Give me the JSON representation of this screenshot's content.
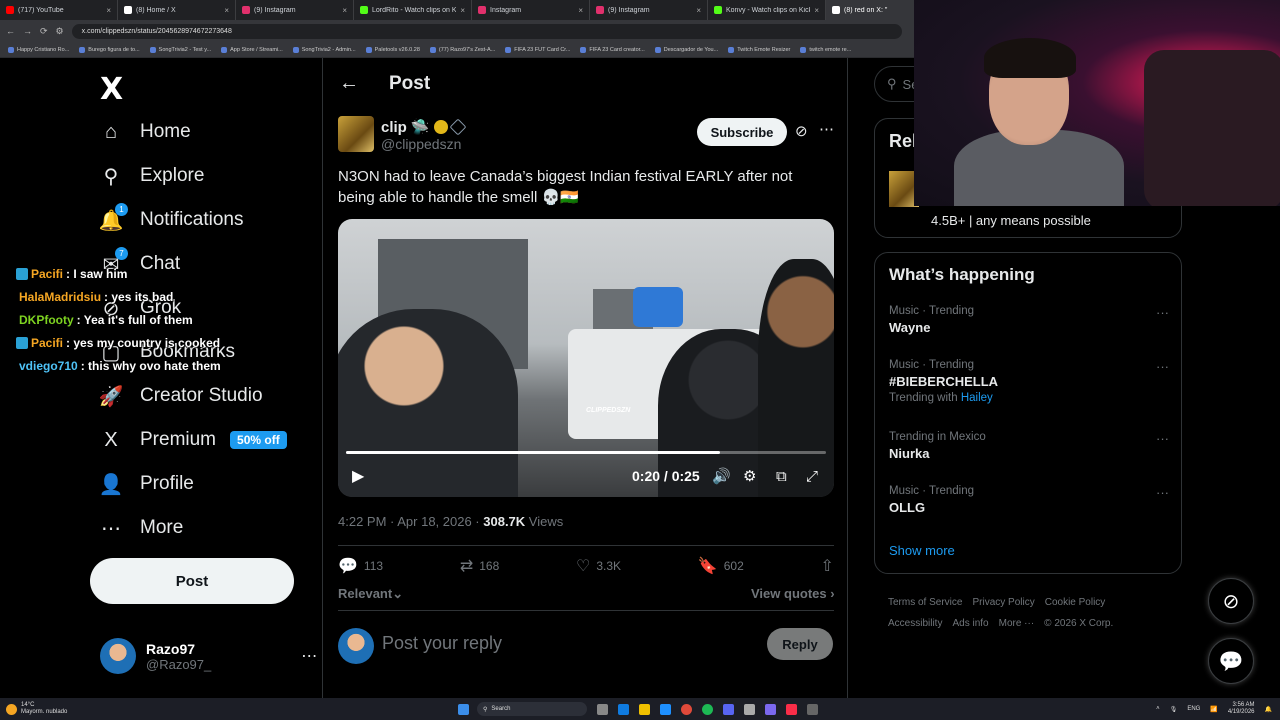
{
  "browser": {
    "tabs": [
      {
        "label": "(717) YouTube",
        "color": "#ff0000",
        "active": false
      },
      {
        "label": "(8) Home / X",
        "color": "#ffffff",
        "active": false
      },
      {
        "label": "(9) Instagram",
        "color": "#e1306c",
        "active": false
      },
      {
        "label": "LordRito - Watch clips on Kick",
        "color": "#53fc18",
        "active": false
      },
      {
        "label": "Instagram",
        "color": "#e1306c",
        "active": false
      },
      {
        "label": "(9) Instagram",
        "color": "#e1306c",
        "active": false
      },
      {
        "label": "Konvy - Watch clips on Kick",
        "color": "#53fc18",
        "active": false
      },
      {
        "label": "(8) red on X: \"",
        "color": "#ffffff",
        "active": true
      }
    ],
    "url": "x.com/clippedszn/status/2045628974672273648",
    "bookmarks": [
      "Happy Cristiano Ro...",
      "Burego figura de to...",
      "SongTrivia2 - Test y...",
      "App Store / Streami...",
      "SongTrivia2 - Admin...",
      "Paletools v26.0.28",
      "(77) Razo97's Zest-A...",
      "FIFA 23 FUT Card Cr...",
      "FIFA 23 Card creator...",
      "Descargador de You...",
      "Twitch Emote Resizer",
      "twitch emote re..."
    ]
  },
  "nav": {
    "logo": "X",
    "items": [
      {
        "name": "home",
        "label": "Home",
        "icon": "⌂",
        "badge": ""
      },
      {
        "name": "explore",
        "label": "Explore",
        "icon": "⚲",
        "badge": ""
      },
      {
        "name": "notifications",
        "label": "Notifications",
        "icon": "🔔",
        "badge": "1"
      },
      {
        "name": "chat",
        "label": "Chat",
        "icon": "✉",
        "badge": "7"
      },
      {
        "name": "grok",
        "label": "Grok",
        "icon": "⊘",
        "badge": ""
      },
      {
        "name": "bookmarks",
        "label": "Bookmarks",
        "icon": "▢",
        "badge": ""
      },
      {
        "name": "creator-studio",
        "label": "Creator Studio",
        "icon": "🚀",
        "badge": ""
      },
      {
        "name": "premium",
        "label": "Premium",
        "icon": "X",
        "badge": ""
      },
      {
        "name": "profile",
        "label": "Profile",
        "icon": "👤",
        "badge": ""
      },
      {
        "name": "more",
        "label": "More",
        "icon": "⋯",
        "badge": ""
      }
    ],
    "premium_promo": "50% off",
    "post_button": "Post",
    "account": {
      "name": "Razo97",
      "handle": "@Razo97_"
    }
  },
  "chat_overlay": [
    {
      "user": "Pacifi",
      "color": "#f5a623",
      "message": " : I saw him",
      "badge": true
    },
    {
      "user": "HalaMadridsiu",
      "color": "#f5a623",
      "message": " : yes its bad",
      "badge": false
    },
    {
      "user": "DKPfooty",
      "color": "#7ed321",
      "message": " : Yea it's full of them",
      "badge": false
    },
    {
      "user": "Pacifi",
      "color": "#f5a623",
      "message": " : yes my country is cooked",
      "badge": true
    },
    {
      "user": "vdiego710",
      "color": "#4fc3f7",
      "message": " : this why ovo hate them",
      "badge": false
    }
  ],
  "post": {
    "header_title": "Post",
    "author_name": "clip",
    "author_handle": "@clippedszn",
    "subscribe_label": "Subscribe",
    "text": "N3ON had to leave Canada’s biggest Indian festival EARLY after not being able to handle the smell 💀🇮🇳",
    "video": {
      "time": "0:20 / 0:25",
      "progress": 0.78,
      "watermark": "CLIPPEDSZN"
    },
    "timestamp": "4:22 PM · Apr 18, 2026 · ",
    "views_count": "308.7K",
    "views_label": " Views",
    "stats": {
      "replies": "113",
      "reposts": "168",
      "likes": "3.3K",
      "bookmarks": "602"
    },
    "sort_label": "Relevant",
    "view_quotes": "View quotes",
    "reply_placeholder": "Post your reply",
    "reply_button": "Reply"
  },
  "sidebar": {
    "search_placeholder": "Se",
    "relevant_heading": "Rel",
    "relevant_bio": "4.5B+ | any means possible",
    "happening_heading": "What’s happening",
    "trends": [
      {
        "context": "Music · Trending",
        "title": "Wayne",
        "with_label": "",
        "with_link": ""
      },
      {
        "context": "Music · Trending",
        "title": "#BIEBERCHELLA",
        "with_label": "Trending with ",
        "with_link": "Hailey"
      },
      {
        "context": "Trending in Mexico",
        "title": "Niurka",
        "with_label": "",
        "with_link": ""
      },
      {
        "context": "Music · Trending",
        "title": "OLLG",
        "with_label": "",
        "with_link": ""
      }
    ],
    "show_more": "Show more",
    "footer": [
      "Terms of Service",
      "Privacy Policy",
      "Cookie Policy",
      "Accessibility",
      "Ads info",
      "More ···",
      "© 2026 X Corp."
    ]
  },
  "taskbar": {
    "weather_temp": "14°C",
    "weather_desc": "Mayorm. nublado",
    "search_label": "Search",
    "lang": "ENG",
    "time": "3:56 AM",
    "date": "4/19/2026"
  }
}
